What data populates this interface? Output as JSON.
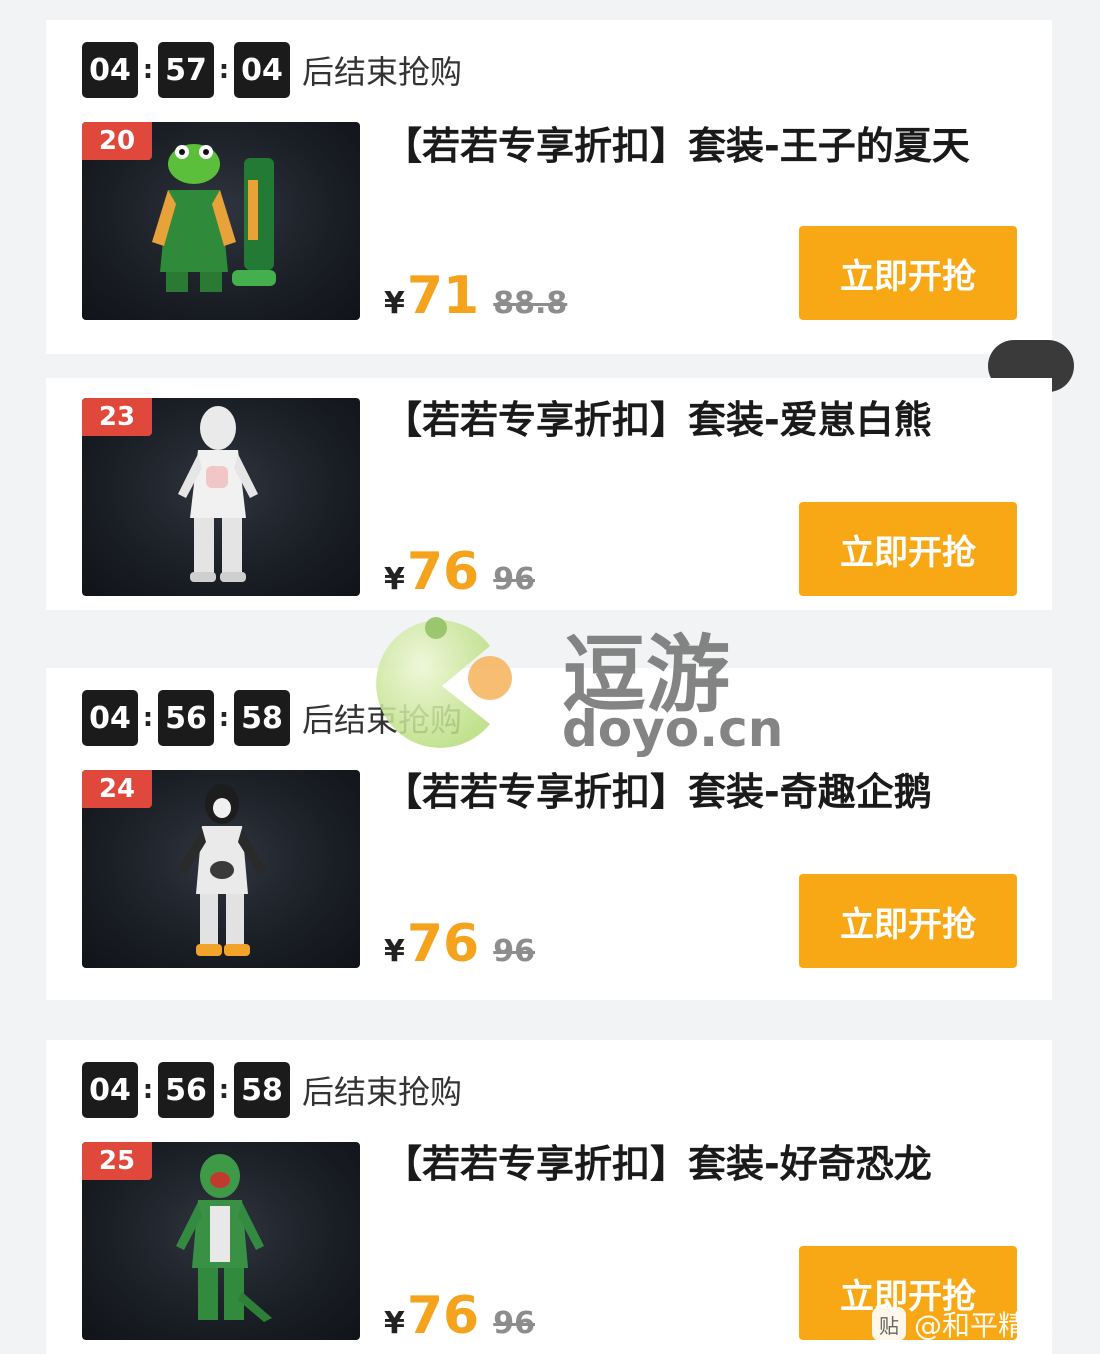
{
  "timer_suffix": "后结束抢购",
  "buy_label": "立即开抢",
  "currency": "¥",
  "items": [
    {
      "rank": "20",
      "title": "【若若专享折扣】套装-王子的夏天",
      "price": "71",
      "original_price": "88.8",
      "timer": [
        "04",
        "57",
        "04"
      ],
      "outfit_icon": "frog-outfit-icon"
    },
    {
      "rank": "23",
      "title": "【若若专享折扣】套装-爱崽白熊",
      "price": "76",
      "original_price": "96",
      "outfit_icon": "polar-bear-outfit-icon"
    },
    {
      "rank": "24",
      "title": "【若若专享折扣】套装-奇趣企鹅",
      "price": "76",
      "original_price": "96",
      "timer": [
        "04",
        "56",
        "58"
      ],
      "outfit_icon": "penguin-outfit-icon"
    },
    {
      "rank": "25",
      "title": "【若若专享折扣】套装-好奇恐龙",
      "price": "76",
      "original_price": "96",
      "timer": [
        "04",
        "56",
        "58"
      ],
      "outfit_icon": "dinosaur-outfit-icon"
    }
  ],
  "watermark": {
    "name": "逗游",
    "domain": "doyo.cn"
  },
  "weibo": {
    "icon_label": "贴",
    "text": "@和平精英"
  },
  "colors": {
    "accent": "#f9a815",
    "price": "#f5a21d",
    "badge": "#e0483c",
    "timer_bg": "#1b1b1b"
  }
}
